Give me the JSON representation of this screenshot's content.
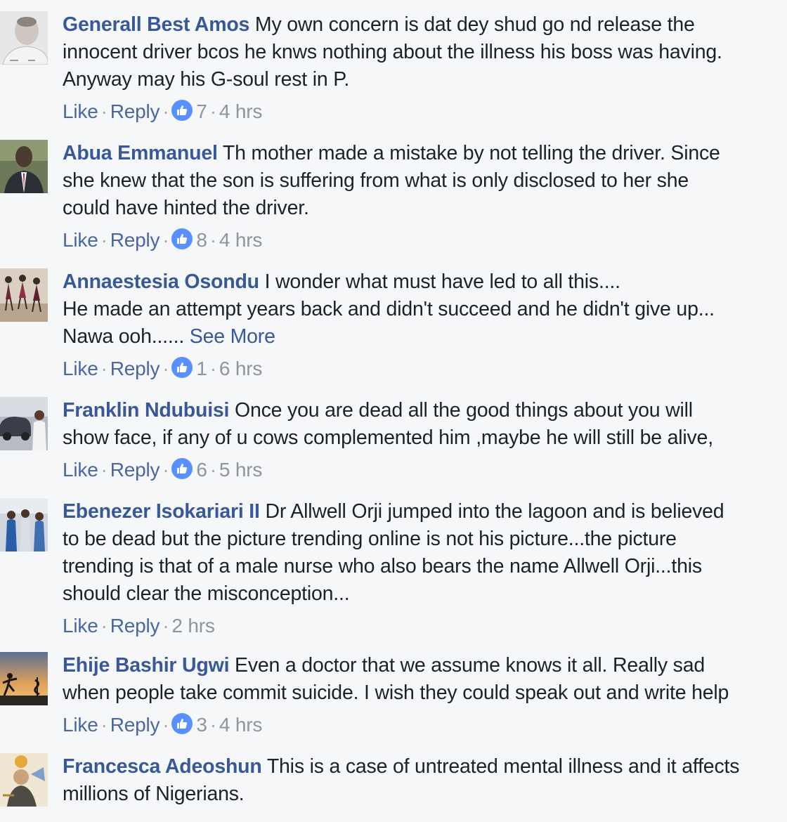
{
  "comments": [
    {
      "avatar": "man-portrait-avatar",
      "name": "Generall Best Amos",
      "lines": [
        "My own concern is dat dey shud go nd release the",
        "innocent driver bcos he knws nothing about the illness his boss was having.",
        "Anyway may his G-soul rest in P."
      ],
      "like_label": "Like",
      "reply_label": "Reply",
      "reactions": "7",
      "time": "4 hrs"
    },
    {
      "avatar": "man-in-suit-avatar",
      "name": "Abua Emmanuel",
      "lines": [
        "Th mother made a mistake by not telling the driver. Since",
        "she knew that the son is suffering from what is only disclosed to her she",
        "could have hinted the driver."
      ],
      "like_label": "Like",
      "reply_label": "Reply",
      "reactions": "8",
      "time": "4 hrs"
    },
    {
      "avatar": "dancers-avatar",
      "name": "Annaestesia Osondu",
      "lines": [
        "I wonder what must have led to all this....",
        "He made an attempt years back and didn't succeed and he didn't give up...",
        "Nawa ooh......"
      ],
      "see_more": "See More",
      "like_label": "Like",
      "reply_label": "Reply",
      "reactions": "1",
      "time": "6 hrs"
    },
    {
      "avatar": "street-car-avatar",
      "name": "Franklin Ndubuisi",
      "lines": [
        "Once you are dead all the good things about you will",
        "show face, if any of u cows complemented him ,maybe he will still be alive,"
      ],
      "like_label": "Like",
      "reply_label": "Reply",
      "reactions": "6",
      "time": "5 hrs"
    },
    {
      "avatar": "group-photo-avatar",
      "name": "Ebenezer Isokariari II",
      "lines": [
        "Dr Allwell Orji jumped into the lagoon and is believed",
        "to be dead but the picture trending online is not his picture...the picture",
        "trending is that of a male nurse who also bears the name Allwell Orji...this",
        "should clear the misconception..."
      ],
      "like_label": "Like",
      "reply_label": "Reply",
      "reactions": "",
      "time": "2 hrs"
    },
    {
      "avatar": "sunset-silhouette-avatar",
      "name": "Ehije Bashir Ugwi",
      "lines": [
        "Even a doctor that we assume knows it all. Really sad",
        "when people take commit suicide. I wish they could speak out and write help"
      ],
      "like_label": "Like",
      "reply_label": "Reply",
      "reactions": "3",
      "time": "4 hrs"
    },
    {
      "avatar": "illustration-avatar",
      "name": "Francesca Adeoshun",
      "lines": [
        "This is a case of untreated mental illness and it affects",
        "millions of Nigerians."
      ],
      "like_label": "",
      "reply_label": "",
      "reactions": "",
      "time": ""
    }
  ]
}
